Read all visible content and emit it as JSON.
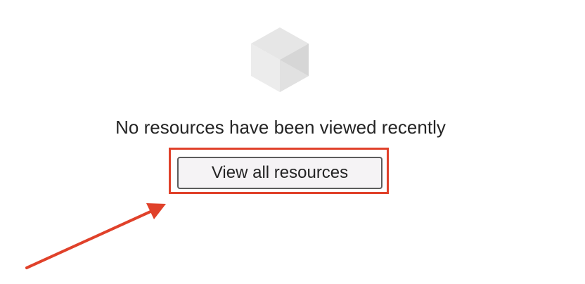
{
  "empty_state": {
    "icon": "cube-icon",
    "message": "No resources have been viewed recently",
    "button_label": "View all resources"
  },
  "annotation": {
    "highlight_color": "#e0412a",
    "arrow_color": "#e0412a"
  }
}
